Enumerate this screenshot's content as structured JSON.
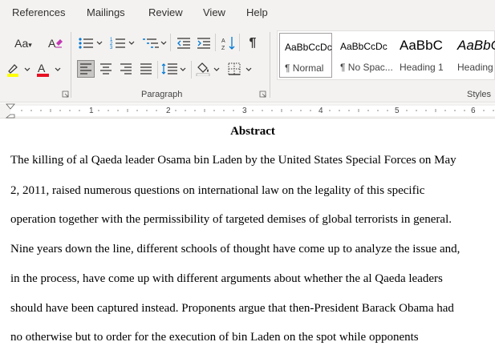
{
  "ribbon_tabs": [
    "References",
    "Mailings",
    "Review",
    "View",
    "Help"
  ],
  "groups": {
    "paragraph_label": "Paragraph",
    "styles_label": "Styles"
  },
  "font_controls": {
    "font_size_icon": "change-case-icon",
    "clear_format_icon": "clear-formatting-icon",
    "highlight_color": "#ffff00",
    "font_color": "#e81123"
  },
  "styles": [
    {
      "preview": "AaBbCcDc",
      "name": "¶ Normal"
    },
    {
      "preview": "AaBbCcDc",
      "name": "¶ No Spac..."
    },
    {
      "preview": "AaBbC",
      "name": "Heading 1"
    },
    {
      "preview": "AaBbC",
      "name": "Heading"
    }
  ],
  "ruler_numbers": [
    "1",
    "2",
    "3",
    "4",
    "5",
    "6"
  ],
  "document": {
    "title": "Abstract",
    "lines": [
      "The killing of al Qaeda leader Osama bin Laden by the United States Special Forces on May",
      "2, 2011, raised numerous questions on international law on the legality of this specific",
      "operation together with the permissibility of targeted demises of global terrorists in general.",
      "Nine years down the line, different schools of thought have come up to analyze the issue and,",
      "in the process, have come up with different arguments about whether the al Qaeda leaders",
      "should have been captured instead. Proponents argue that then-President Barack Obama had",
      "no otherwise but to order for the execution of bin Laden on the spot while opponents"
    ]
  }
}
